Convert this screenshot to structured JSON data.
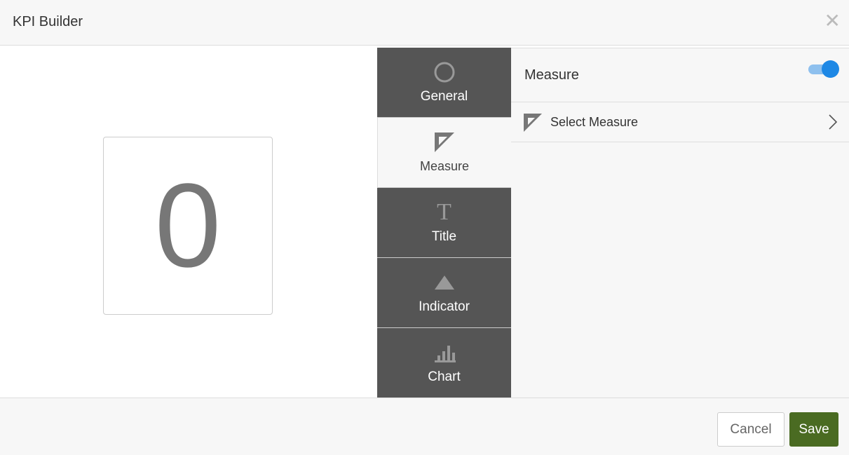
{
  "header": {
    "title": "KPI Builder",
    "close_icon": "close-icon"
  },
  "preview": {
    "value": "0"
  },
  "tabs": [
    {
      "label": "General",
      "icon": "circle-icon"
    },
    {
      "label": "Measure",
      "icon": "ruler-icon",
      "active": true
    },
    {
      "label": "Title",
      "icon": "text-icon"
    },
    {
      "label": "Indicator",
      "icon": "triangle-icon"
    },
    {
      "label": "Chart",
      "icon": "bar-chart-icon"
    }
  ],
  "panel": {
    "measure_label": "Measure",
    "measure_enabled": true,
    "select_label": "Select Measure"
  },
  "footer": {
    "cancel": "Cancel",
    "save": "Save"
  },
  "colors": {
    "accent": "#1e88e5",
    "save": "#4a6b22",
    "tab_bg": "#555555"
  }
}
